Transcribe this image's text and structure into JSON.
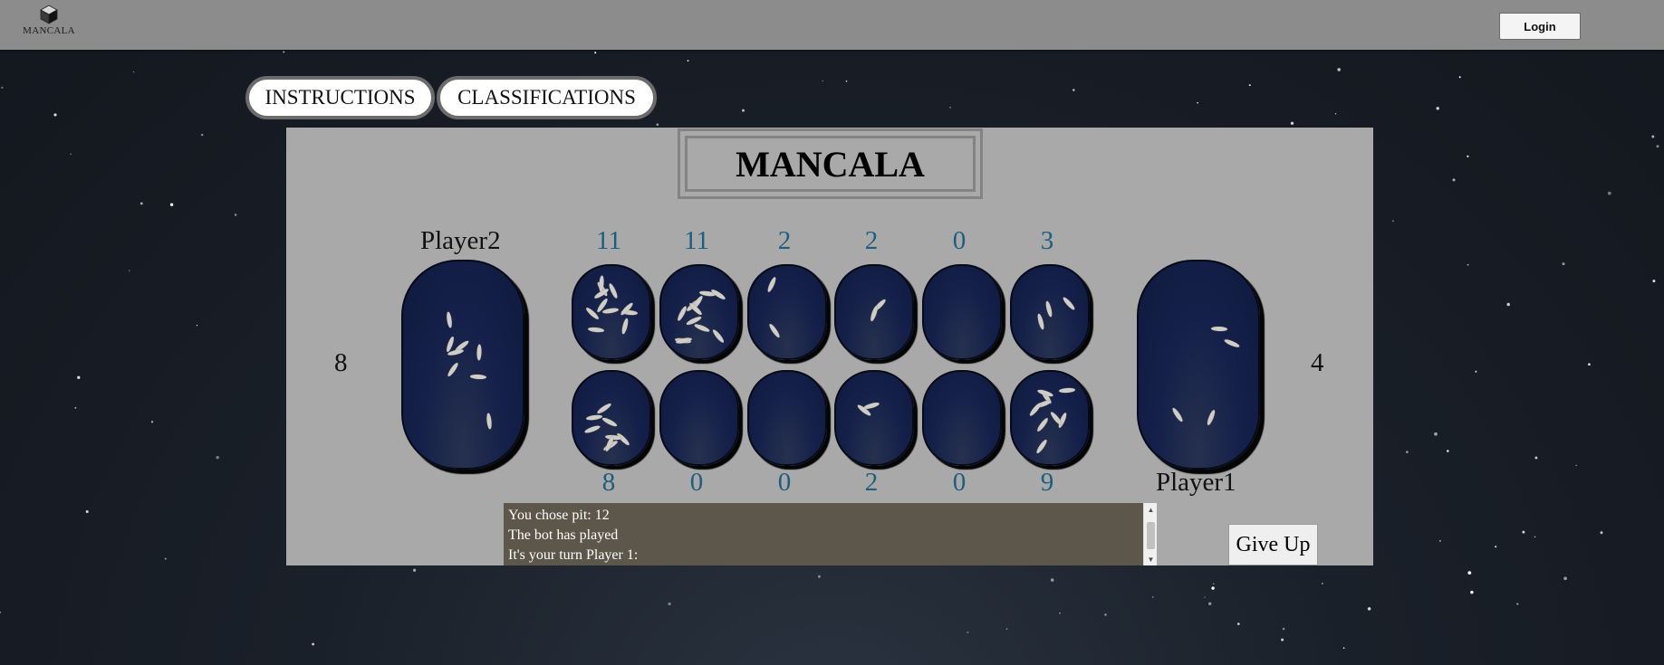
{
  "header": {
    "logo_text": "MANCALA",
    "login_label": "Login"
  },
  "nav": {
    "instructions_label": "INSTRUCTIONS",
    "classifications_label": "CLASSIFICATIONS"
  },
  "game": {
    "title": "MANCALA",
    "player2_label": "Player2",
    "player1_label": "Player1",
    "player2_score": "8",
    "player1_score": "4",
    "top_row_counts": [
      "11",
      "11",
      "2",
      "2",
      "0",
      "3"
    ],
    "bottom_row_counts": [
      "8",
      "0",
      "0",
      "2",
      "0",
      "9"
    ],
    "log": {
      "line1": "You chose pit: 12",
      "line2": "The bot has played",
      "line3": "It's your turn Player 1:"
    },
    "give_up_label": "Give Up"
  },
  "colors": {
    "background": "#13171e",
    "topbar": "#8c8c8c",
    "board": "#a9a9a9",
    "pit": "#15204a",
    "pit_count": "#1d5d7e",
    "log_background": "#5c574a",
    "stone": "#cfcdc6"
  }
}
